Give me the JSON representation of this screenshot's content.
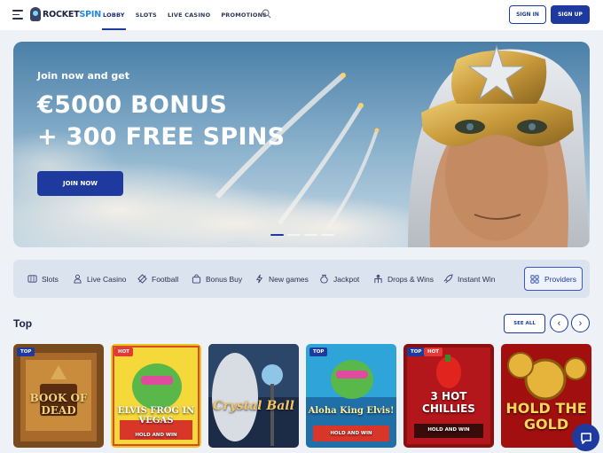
{
  "header": {
    "logo": {
      "part1": "ROCKET",
      "part2": "SPIN"
    },
    "nav": [
      {
        "label": "LOBBY",
        "active": true
      },
      {
        "label": "SLOTS",
        "active": false
      },
      {
        "label": "LIVE CASINO",
        "active": false
      },
      {
        "label": "PROMOTIONS",
        "active": false
      }
    ],
    "signin_label": "SIGN IN",
    "signup_label": "SIGN UP"
  },
  "hero": {
    "pre": "Join now and get",
    "line1": "€5000 BONUS",
    "line2": "+ 300 FREE SPINS",
    "cta": "JOIN NOW",
    "slides": 4,
    "active_slide": 1
  },
  "categories": [
    {
      "label": "Slots",
      "icon": "slots-icon"
    },
    {
      "label": "Live Casino",
      "icon": "live-casino-icon"
    },
    {
      "label": "Football",
      "icon": "football-icon"
    },
    {
      "label": "Bonus Buy",
      "icon": "bonus-buy-icon"
    },
    {
      "label": "New games",
      "icon": "new-games-icon"
    },
    {
      "label": "Jackpot",
      "icon": "jackpot-icon"
    },
    {
      "label": "Drops & Wins",
      "icon": "drops-wins-icon"
    },
    {
      "label": "Instant Win",
      "icon": "instant-win-icon"
    }
  ],
  "providers_label": "Providers",
  "top_section": {
    "title": "Top",
    "see_all": "SEE ALL",
    "prev": "‹",
    "next": "›"
  },
  "games": [
    {
      "title": "BOOK OF DEAD",
      "badges": [
        "TOP"
      ]
    },
    {
      "title": "ELVIS FROG IN VEGAS",
      "sub": "HOLD AND WIN",
      "badges": [
        "HOT"
      ]
    },
    {
      "title": "Crystal Ball",
      "badges": []
    },
    {
      "title": "Aloha King Elvis!",
      "sub": "HOLD AND WIN",
      "badges": [
        "TOP"
      ]
    },
    {
      "title": "3 HOT CHILLIES",
      "sub": "HOLD AND WIN",
      "badges": [
        "TOP",
        "HOT"
      ]
    },
    {
      "title": "HOLD THE GOLD",
      "badges": []
    }
  ],
  "colors": {
    "brand": "#1e3a9e",
    "hot": "#e53935",
    "accent": "#1e88e5"
  }
}
